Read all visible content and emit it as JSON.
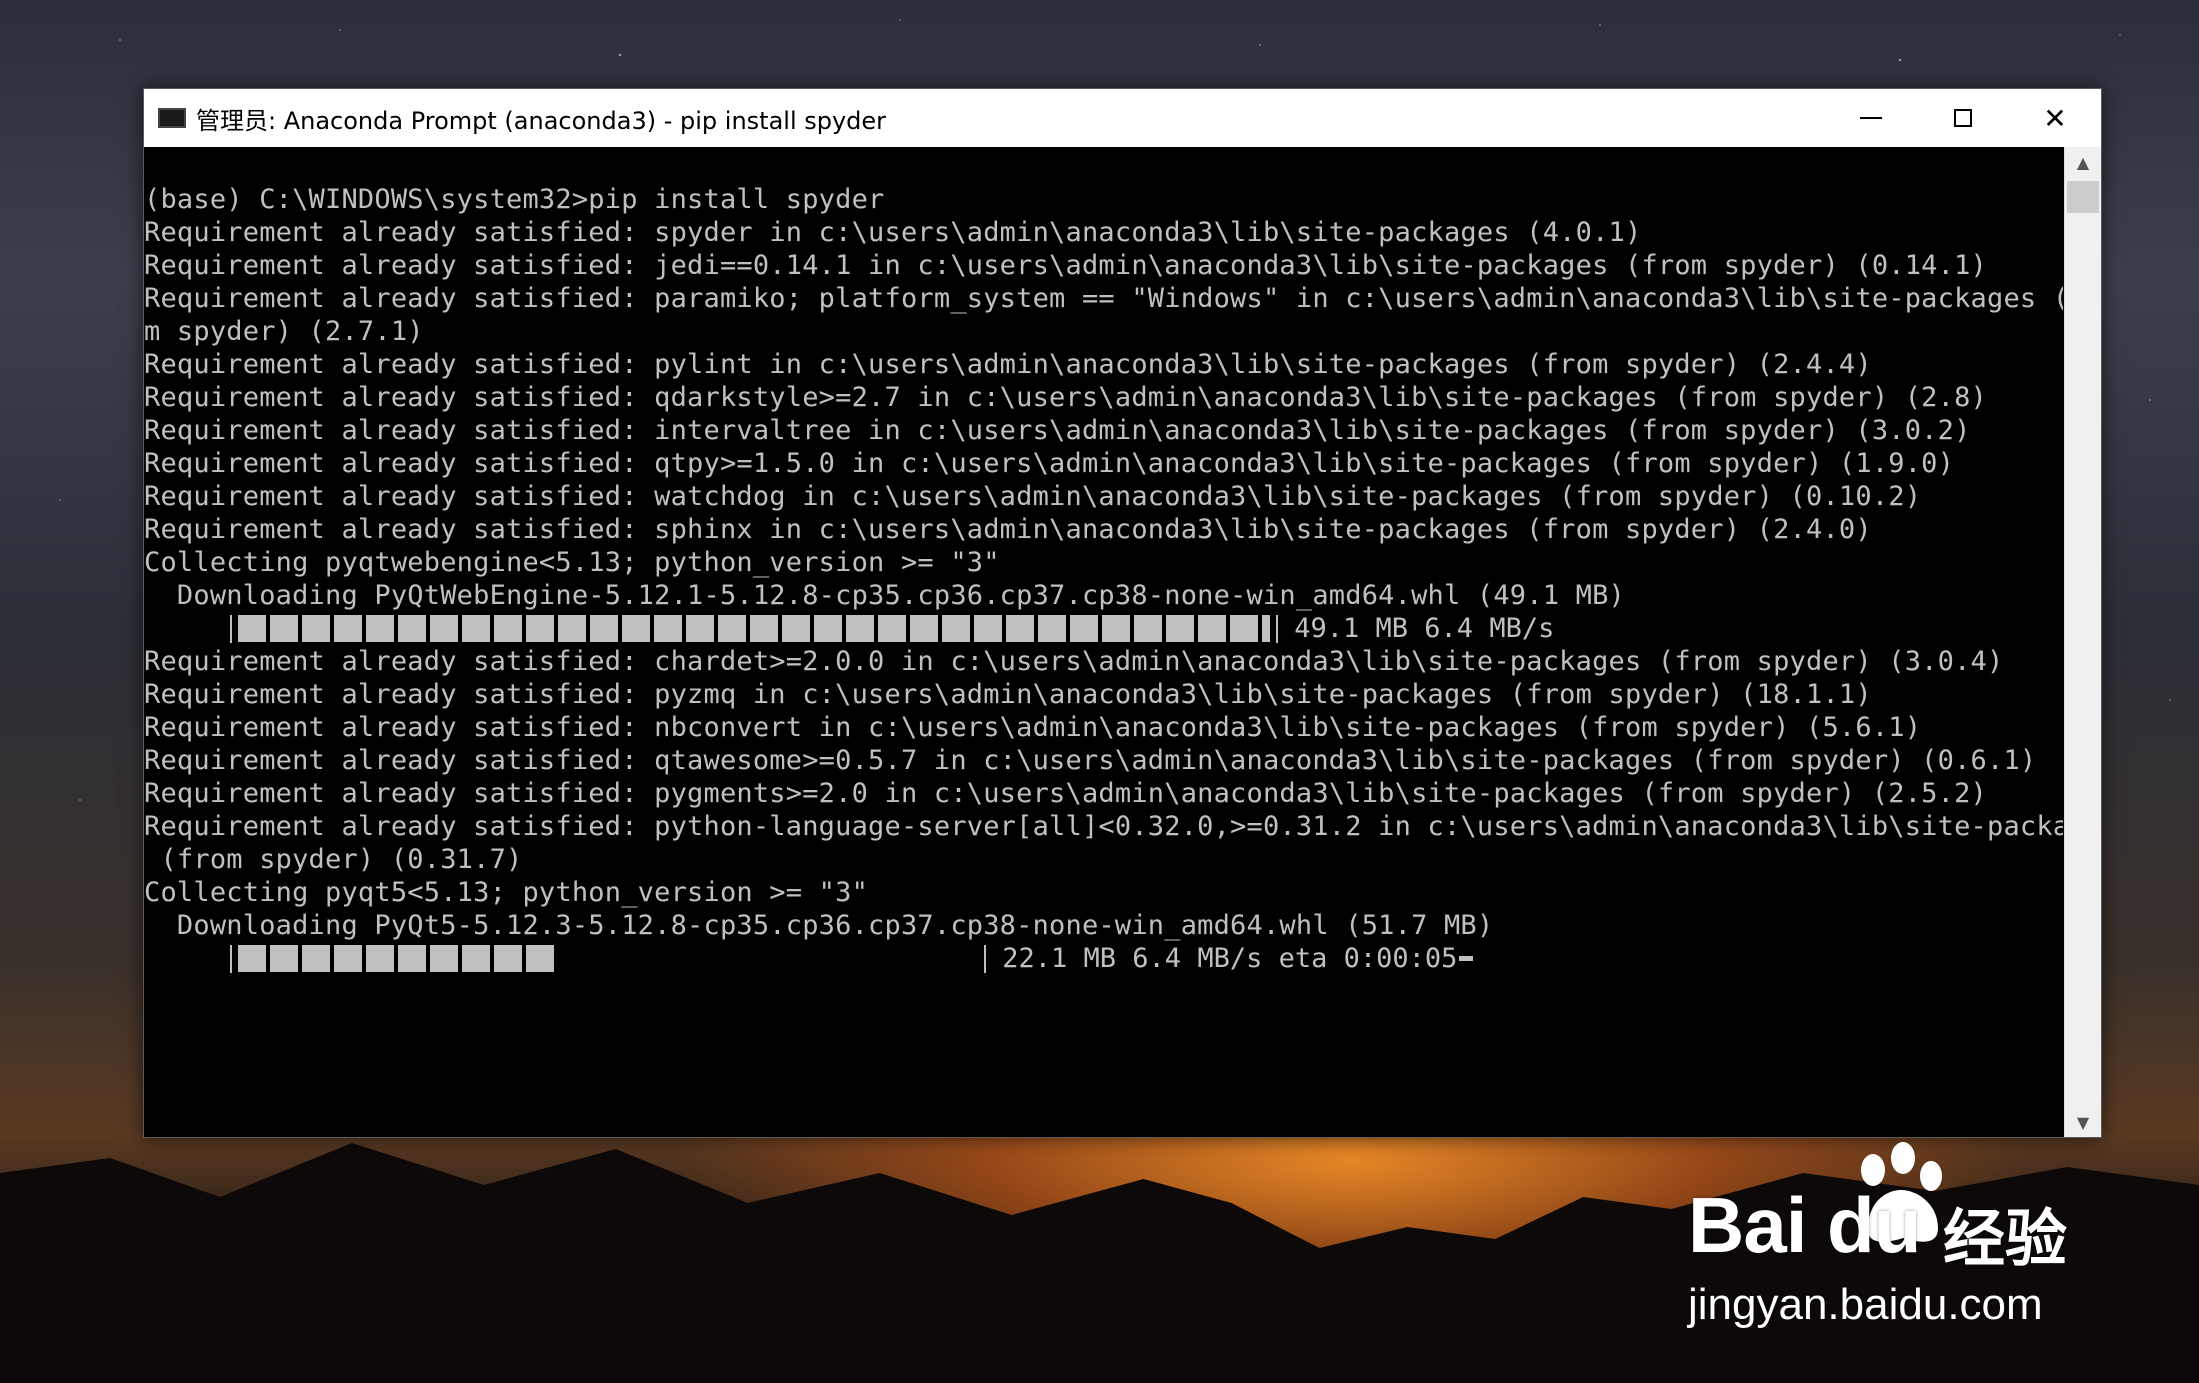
{
  "window": {
    "title": "管理员: Anaconda Prompt (anaconda3) - pip  install spyder",
    "controls": {
      "minimize": "minimize",
      "maximize": "maximize",
      "close": "✕"
    }
  },
  "console": {
    "lines": [
      "(base) C:\\WINDOWS\\system32>pip install spyder",
      "Requirement already satisfied: spyder in c:\\users\\admin\\anaconda3\\lib\\site-packages (4.0.1)",
      "Requirement already satisfied: jedi==0.14.1 in c:\\users\\admin\\anaconda3\\lib\\site-packages (from spyder) (0.14.1)",
      "Requirement already satisfied: paramiko; platform_system == \"Windows\" in c:\\users\\admin\\anaconda3\\lib\\site-packages (fro",
      "m spyder) (2.7.1)",
      "Requirement already satisfied: pylint in c:\\users\\admin\\anaconda3\\lib\\site-packages (from spyder) (2.4.4)",
      "Requirement already satisfied: qdarkstyle>=2.7 in c:\\users\\admin\\anaconda3\\lib\\site-packages (from spyder) (2.8)",
      "Requirement already satisfied: intervaltree in c:\\users\\admin\\anaconda3\\lib\\site-packages (from spyder) (3.0.2)",
      "Requirement already satisfied: qtpy>=1.5.0 in c:\\users\\admin\\anaconda3\\lib\\site-packages (from spyder) (1.9.0)",
      "Requirement already satisfied: watchdog in c:\\users\\admin\\anaconda3\\lib\\site-packages (from spyder) (0.10.2)",
      "Requirement already satisfied: sphinx in c:\\users\\admin\\anaconda3\\lib\\site-packages (from spyder) (2.4.0)",
      "Collecting pyqtwebengine<5.13; python_version >= \"3\"",
      "  Downloading PyQtWebEngine-5.12.1-5.12.8-cp35.cp36.cp37.cp38-none-win_amd64.whl (49.1 MB)"
    ],
    "progress1": {
      "fraction": 1.0,
      "text": " 49.1 MB 6.4 MB/s"
    },
    "lines2": [
      "Requirement already satisfied: chardet>=2.0.0 in c:\\users\\admin\\anaconda3\\lib\\site-packages (from spyder) (3.0.4)",
      "Requirement already satisfied: pyzmq in c:\\users\\admin\\anaconda3\\lib\\site-packages (from spyder) (18.1.1)",
      "Requirement already satisfied: nbconvert in c:\\users\\admin\\anaconda3\\lib\\site-packages (from spyder) (5.6.1)",
      "Requirement already satisfied: qtawesome>=0.5.7 in c:\\users\\admin\\anaconda3\\lib\\site-packages (from spyder) (0.6.1)",
      "Requirement already satisfied: pygments>=2.0 in c:\\users\\admin\\anaconda3\\lib\\site-packages (from spyder) (2.5.2)",
      "Requirement already satisfied: python-language-server[all]<0.32.0,>=0.31.2 in c:\\users\\admin\\anaconda3\\lib\\site-packages",
      " (from spyder) (0.31.7)",
      "Collecting pyqt5<5.13; python_version >= \"3\"",
      "  Downloading PyQt5-5.12.3-5.12.8-cp35.cp36.cp37.cp38-none-win_amd64.whl (51.7 MB)"
    ],
    "progress2": {
      "fraction": 0.43,
      "text": " 22.1 MB 6.4 MB/s eta 0:00:05"
    }
  },
  "scrollbar": {
    "up_icon": "▲",
    "down_icon": "▼"
  },
  "watermark": {
    "brand": "Bai  du",
    "brand_cn": "经验",
    "url": "jingyan.baidu.com"
  }
}
